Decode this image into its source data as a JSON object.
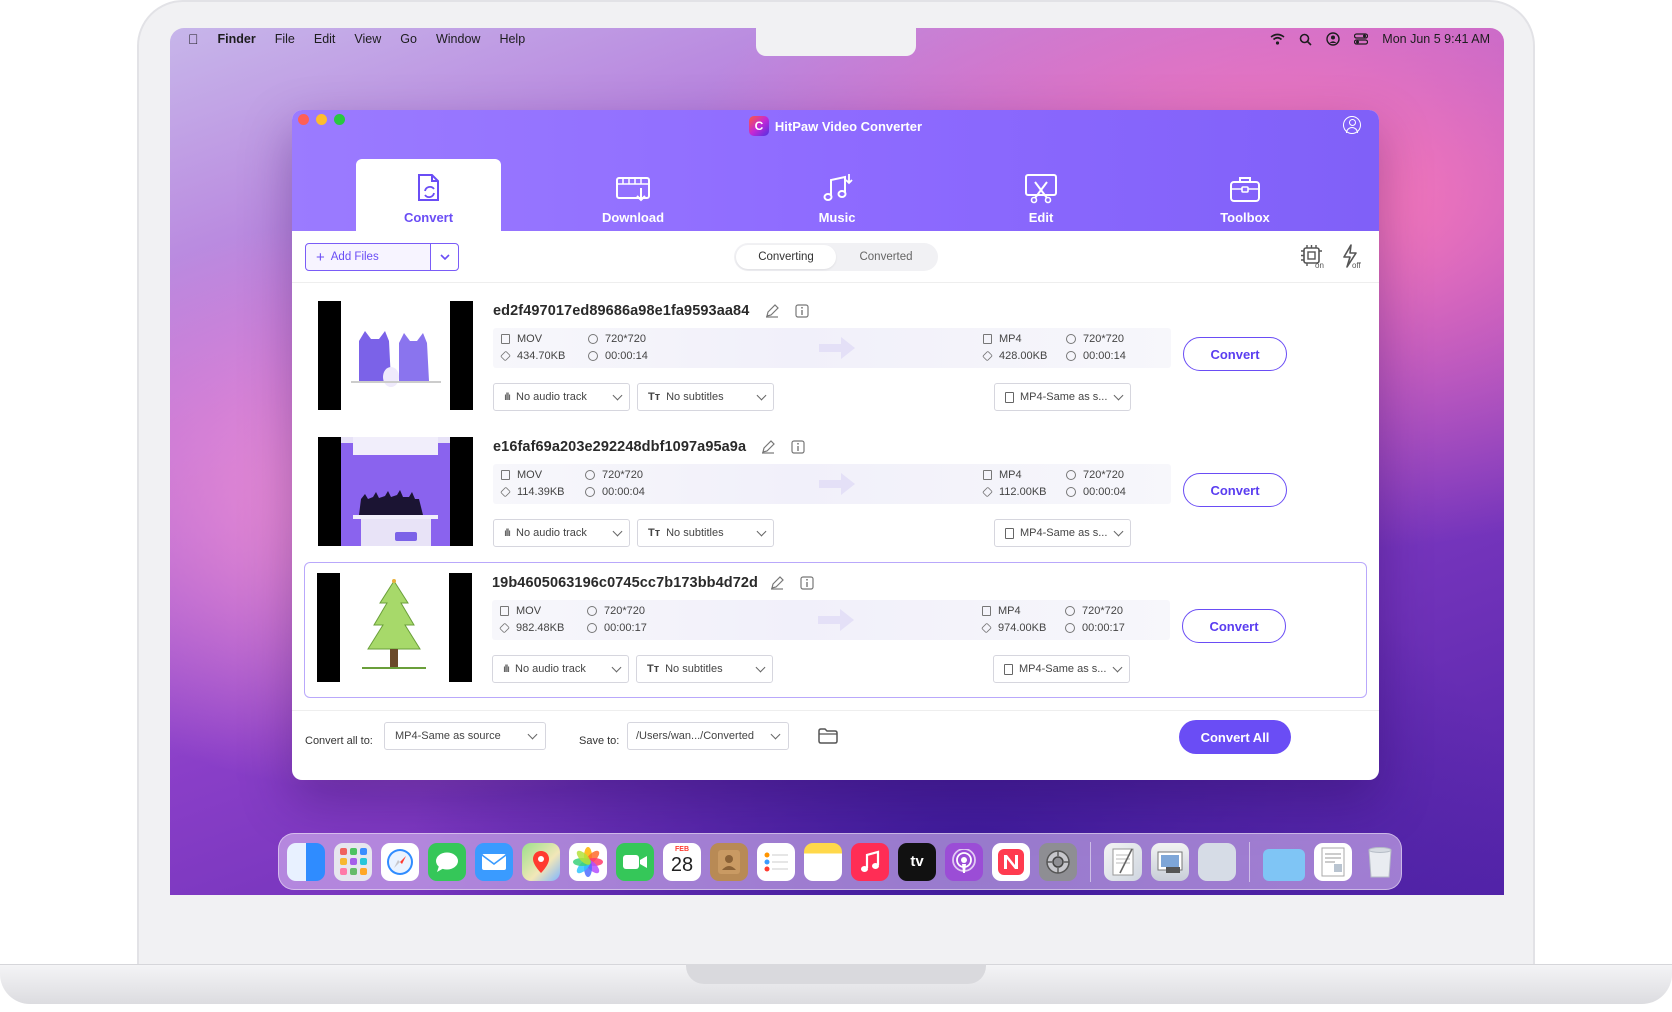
{
  "menubar": {
    "app": "Finder",
    "items": [
      "File",
      "Edit",
      "View",
      "Go",
      "Window",
      "Help"
    ],
    "datetime": "Mon Jun 5  9:41 AM"
  },
  "window": {
    "title": "HitPaw Video Converter"
  },
  "tabs": [
    {
      "label": "Convert",
      "icon": "convert-icon"
    },
    {
      "label": "Download",
      "icon": "download-icon"
    },
    {
      "label": "Music",
      "icon": "music-icon"
    },
    {
      "label": "Edit",
      "icon": "edit-icon"
    },
    {
      "label": "Toolbox",
      "icon": "toolbox-icon"
    }
  ],
  "toolbar": {
    "add_files": "Add Files",
    "segments": [
      "Converting",
      "Converted"
    ],
    "active_segment": "Converting"
  },
  "files": [
    {
      "name": "ed2f497017ed89686a98e1fa9593aa84",
      "src_format": "MOV",
      "src_res": "720*720",
      "src_size": "434.70KB",
      "src_duration": "00:00:14",
      "dst_format": "MP4",
      "dst_res": "720*720",
      "dst_size": "428.00KB",
      "dst_duration": "00:00:14",
      "audio": "No audio track",
      "subtitles": "No subtitles",
      "output": "MP4-Same as s...",
      "action": "Convert"
    },
    {
      "name": "e16faf69a203e292248dbf1097a95a9a",
      "src_format": "MOV",
      "src_res": "720*720",
      "src_size": "114.39KB",
      "src_duration": "00:00:04",
      "dst_format": "MP4",
      "dst_res": "720*720",
      "dst_size": "112.00KB",
      "dst_duration": "00:00:04",
      "audio": "No audio track",
      "subtitles": "No subtitles",
      "output": "MP4-Same as s...",
      "action": "Convert"
    },
    {
      "name": "19b4605063196c0745cc7b173bb4d72d",
      "src_format": "MOV",
      "src_res": "720*720",
      "src_size": "982.48KB",
      "src_duration": "00:00:17",
      "dst_format": "MP4",
      "dst_res": "720*720",
      "dst_size": "974.00KB",
      "dst_duration": "00:00:17",
      "audio": "No audio track",
      "subtitles": "No subtitles",
      "output": "MP4-Same as s...",
      "action": "Convert"
    }
  ],
  "bottom": {
    "convert_all_label": "Convert all to:",
    "convert_all_value": "MP4-Same as source",
    "save_to_label": "Save to:",
    "save_to_value": "/Users/wan.../Converted",
    "convert_all_button": "Convert All"
  },
  "dock": {
    "calendar_month": "FEB",
    "calendar_day": "28",
    "tv_label": "tv"
  },
  "colors": {
    "accent": "#6a4df5",
    "header": "#8e6bff"
  }
}
